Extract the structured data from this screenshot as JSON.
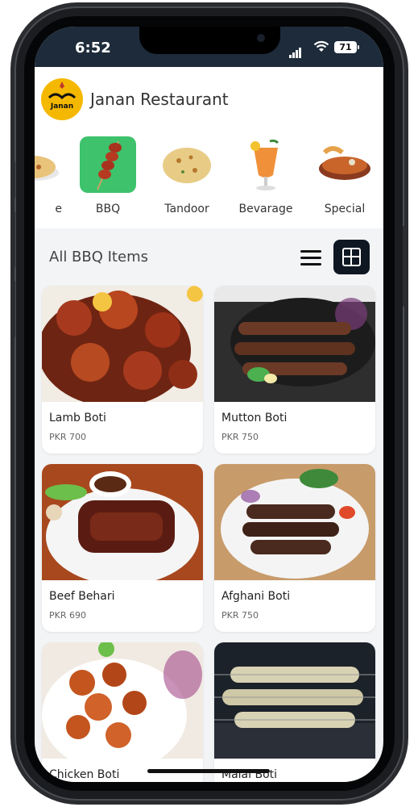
{
  "status": {
    "time": "6:52",
    "battery": "71"
  },
  "header": {
    "title": "Janan Restaurant",
    "logo_text": "Janan"
  },
  "categories": [
    {
      "label": "e"
    },
    {
      "label": "BBQ",
      "active": true
    },
    {
      "label": "Tandoor"
    },
    {
      "label": "Bevarage"
    },
    {
      "label": "Special"
    }
  ],
  "section": {
    "title": "All BBQ Items",
    "view": "grid"
  },
  "items": [
    {
      "name": "Lamb Boti",
      "price": "PKR 700"
    },
    {
      "name": "Mutton Boti",
      "price": "PKR 750"
    },
    {
      "name": "Beef Behari",
      "price": "PKR 690"
    },
    {
      "name": "Afghani Boti",
      "price": "PKR 750"
    },
    {
      "name": "Chicken Boti",
      "price": ""
    },
    {
      "name": "Malai Boti",
      "price": ""
    }
  ],
  "colors": {
    "accent": "#3ec26b",
    "statusbar": "#1d2b3a",
    "grid_button": "#0f1722",
    "logo": "#f5b800"
  }
}
